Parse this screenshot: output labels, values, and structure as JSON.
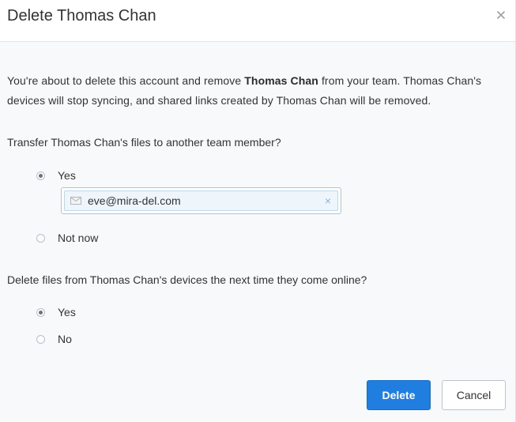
{
  "dialog": {
    "title": "Delete Thomas Chan",
    "close_icon": "close-icon",
    "message": {
      "part1": "You're about to delete this account and remove ",
      "name_bold": "Thomas Chan",
      "part2": " from your team. Thomas Chan's devices will stop syncing, and shared links created by Thomas Chan will be removed."
    },
    "transfer": {
      "question": "Transfer Thomas Chan's files to another team member?",
      "options": [
        {
          "label": "Yes",
          "checked": true
        },
        {
          "label": "Not now",
          "checked": false
        }
      ],
      "recipient_token": "eve@mira-del.com",
      "token_icon": "envelope-icon",
      "remove_icon": "×"
    },
    "delete_files": {
      "question": "Delete files from Thomas Chan's devices the next time they come online?",
      "options": [
        {
          "label": "Yes",
          "checked": true
        },
        {
          "label": "No",
          "checked": false
        }
      ]
    },
    "buttons": {
      "delete_label": "Delete",
      "cancel_label": "Cancel"
    },
    "colors": {
      "primary": "#1f7ee0",
      "background": "#f7f9fa"
    }
  }
}
